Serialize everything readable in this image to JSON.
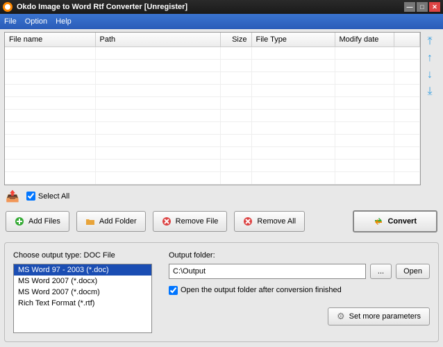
{
  "title": "Okdo Image to Word Rtf Converter [Unregister]",
  "menu": {
    "file": "File",
    "option": "Option",
    "help": "Help"
  },
  "columns": {
    "filename": "File name",
    "path": "Path",
    "size": "Size",
    "filetype": "File Type",
    "modify": "Modify date"
  },
  "selectall": "Select All",
  "buttons": {
    "addfiles": "Add Files",
    "addfolder": "Add Folder",
    "removefile": "Remove File",
    "removeall": "Remove All",
    "convert": "Convert",
    "browse": "...",
    "open": "Open",
    "setmore": "Set more parameters"
  },
  "output_type_label": "Choose output type:  DOC File",
  "output_folder_label": "Output folder:",
  "output_folder_value": "C:\\Output",
  "open_output_cb": "Open the output folder after conversion finished",
  "formats": [
    "MS Word 97 - 2003 (*.doc)",
    "MS Word 2007 (*.docx)",
    "MS Word 2007 (*.docm)",
    "Rich Text Format (*.rtf)"
  ]
}
